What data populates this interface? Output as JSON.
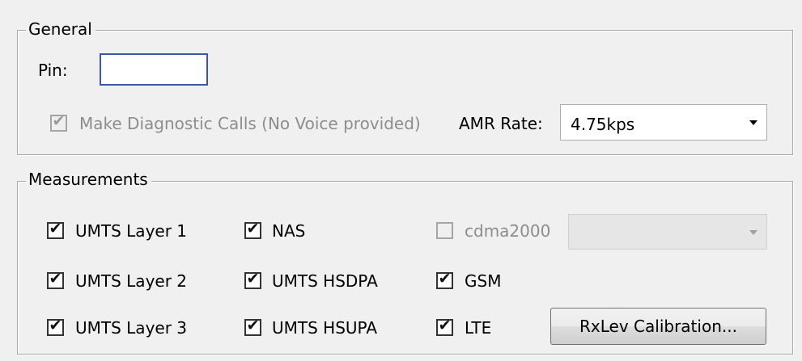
{
  "general": {
    "title": "General",
    "pin_label": "Pin:",
    "pin_value": "",
    "diagnostic_calls": {
      "label": "Make Diagnostic Calls (No Voice provided)",
      "checked": true,
      "enabled": false
    },
    "amr_rate_label": "AMR Rate:",
    "amr_rate_value": "4.75kps"
  },
  "measurements": {
    "title": "Measurements",
    "checkboxes": [
      {
        "label": "UMTS Layer 1",
        "checked": true,
        "enabled": true
      },
      {
        "label": "UMTS Layer 2",
        "checked": true,
        "enabled": true
      },
      {
        "label": "UMTS Layer 3",
        "checked": true,
        "enabled": true
      },
      {
        "label": "NAS",
        "checked": true,
        "enabled": true
      },
      {
        "label": "UMTS HSDPA",
        "checked": true,
        "enabled": true
      },
      {
        "label": "UMTS HSUPA",
        "checked": true,
        "enabled": true
      },
      {
        "label": "cdma2000",
        "checked": false,
        "enabled": false
      },
      {
        "label": "GSM",
        "checked": true,
        "enabled": true
      },
      {
        "label": "LTE",
        "checked": true,
        "enabled": true
      }
    ],
    "cdma2000_select_value": "",
    "rxlev_button_label": "RxLev Calibration..."
  },
  "icons": {
    "check": "✔",
    "dropdown": "chevron-down-icon"
  }
}
